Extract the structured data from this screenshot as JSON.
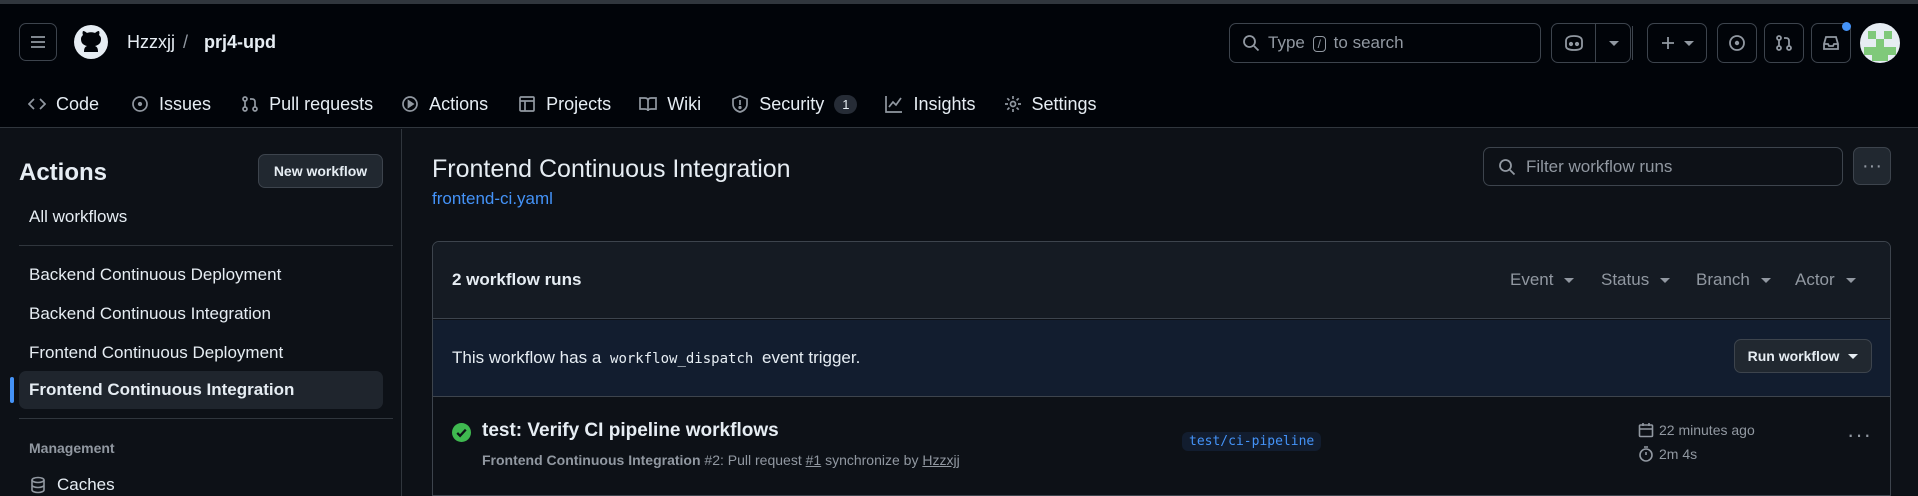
{
  "header": {
    "owner": "Hzzxjj",
    "separator": "/",
    "repo": "prj4-upd",
    "search_prefix": "Type",
    "search_key": "/",
    "search_suffix": "to search"
  },
  "tabs": [
    {
      "label": "Code",
      "icon": "code-icon"
    },
    {
      "label": "Issues",
      "icon": "issue-icon"
    },
    {
      "label": "Pull requests",
      "icon": "pull-request-icon"
    },
    {
      "label": "Actions",
      "icon": "play-icon"
    },
    {
      "label": "Projects",
      "icon": "table-icon"
    },
    {
      "label": "Wiki",
      "icon": "book-icon"
    },
    {
      "label": "Security",
      "icon": "shield-icon",
      "count": "1"
    },
    {
      "label": "Insights",
      "icon": "graph-icon"
    },
    {
      "label": "Settings",
      "icon": "gear-icon"
    }
  ],
  "sidebar": {
    "title": "Actions",
    "new_workflow": "New workflow",
    "all_workflows": "All workflows",
    "workflows": [
      "Backend Continuous Deployment",
      "Backend Continuous Integration",
      "Frontend Continuous Deployment",
      "Frontend Continuous Integration"
    ],
    "management_label": "Management",
    "caches": "Caches"
  },
  "main": {
    "title": "Frontend Continuous Integration",
    "file": "frontend-ci.yaml",
    "filter_placeholder": "Filter workflow runs",
    "runs_count": "2 workflow runs",
    "filters": [
      "Event",
      "Status",
      "Branch",
      "Actor"
    ],
    "banner_prefix": "This workflow has a",
    "banner_code": "workflow_dispatch",
    "banner_suffix": "event trigger.",
    "run_workflow": "Run workflow"
  },
  "run": {
    "title": "test: Verify CI pipeline workflows",
    "workflow": "Frontend Continuous Integration",
    "number": "#2",
    "meta_mid": ": Pull request ",
    "pr": "#1",
    "meta_end": " synchronize by ",
    "actor": "Hzzxjj",
    "branch": "test/ci-pipeline",
    "time_ago": "22 minutes ago",
    "duration": "2m 4s",
    "status_color": "#3fb950"
  },
  "colors": {
    "accent": "#4493f8",
    "background": "#0d1117",
    "header": "#010409"
  }
}
